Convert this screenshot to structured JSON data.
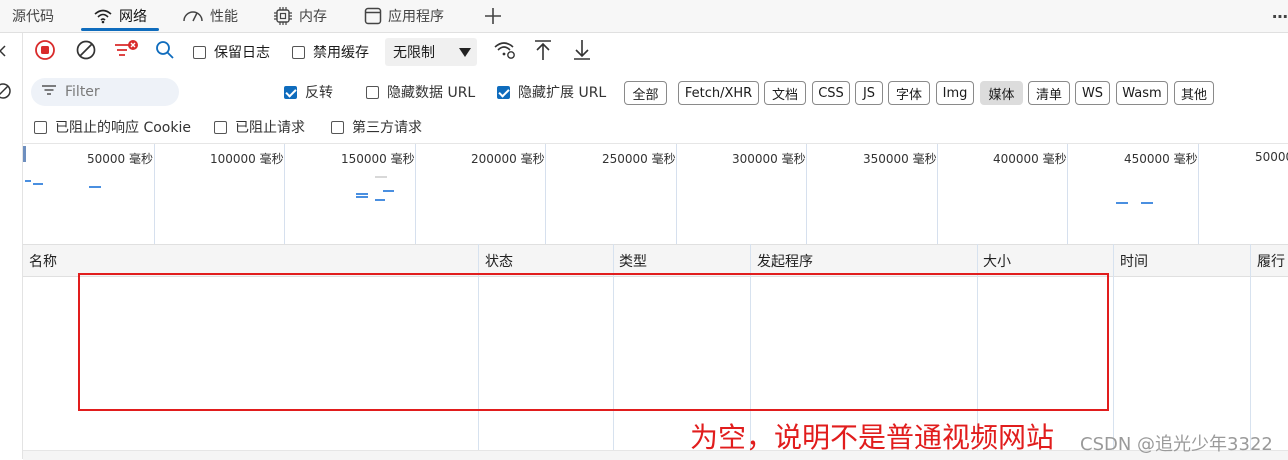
{
  "tabs": [
    {
      "label": "源代码",
      "icon": "source-icon"
    },
    {
      "label": "网络",
      "icon": "wifi-icon",
      "active": true
    },
    {
      "label": "性能",
      "icon": "performance-icon"
    },
    {
      "label": "内存",
      "icon": "memory-chip-icon"
    },
    {
      "label": "应用程序",
      "icon": "application-window-icon"
    },
    {
      "label": "",
      "icon": "plus-icon"
    }
  ],
  "more_menu": "⋯",
  "toolbar": {
    "preserve_log": "保留日志",
    "disable_cache": "禁用缓存",
    "throttling": "无限制"
  },
  "filter": {
    "placeholder": "Filter",
    "invert": "反转",
    "hide_data_url": "隐藏数据 URL",
    "hide_extension_url": "隐藏扩展 URL",
    "chips": [
      "全部",
      "Fetch/XHR",
      "文档",
      "CSS",
      "JS",
      "字体",
      "Img",
      "媒体",
      "清单",
      "WS",
      "Wasm",
      "其他"
    ],
    "selected_chip": "媒体"
  },
  "options": {
    "blocked_cookies": "已阻止的响应 Cookie",
    "blocked_requests": "已阻止请求",
    "third_party": "第三方请求"
  },
  "timeline": {
    "ticks": [
      "50000  毫秒",
      "100000  毫秒",
      "150000  毫秒",
      "200000  毫秒",
      "250000  毫秒",
      "300000  毫秒",
      "350000  毫秒",
      "400000  毫秒",
      "450000  毫秒",
      "50000"
    ]
  },
  "table": {
    "columns": [
      "名称",
      "状态",
      "类型",
      "发起程序",
      "大小",
      "时间",
      "履行"
    ]
  },
  "annotation": "为空，说明不是普通视频网站",
  "watermark": "CSDN @追光少年3322",
  "colors": {
    "accent": "#0f6cbd",
    "annotation_red": "#e11d1d",
    "record_red": "#d92b2b"
  }
}
